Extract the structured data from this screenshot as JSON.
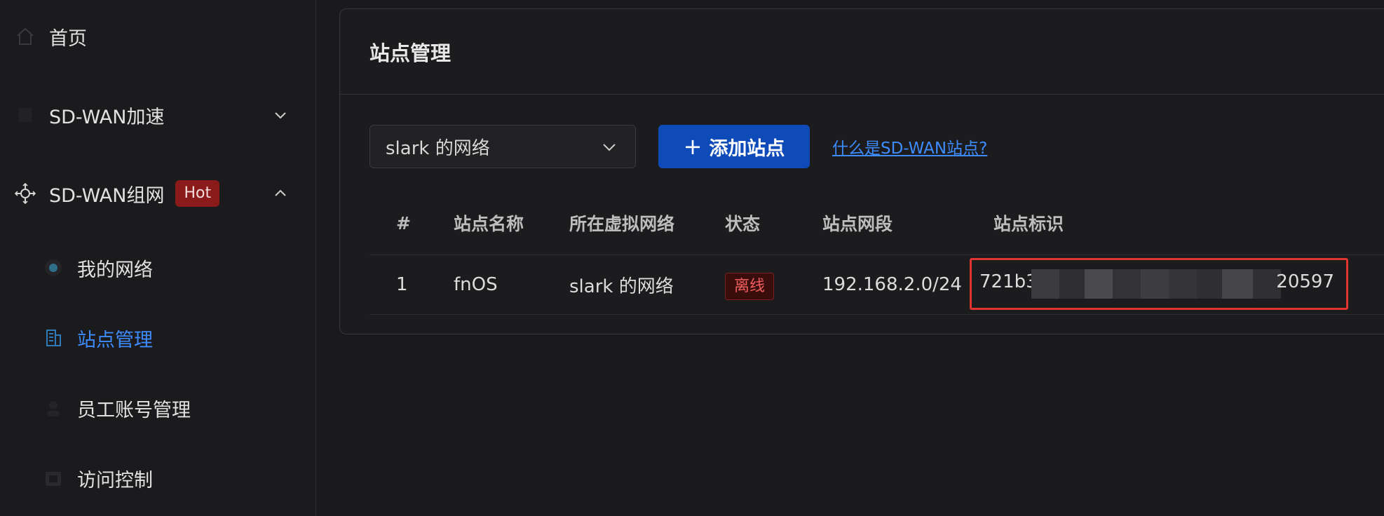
{
  "sidebar": {
    "items": [
      {
        "label": "首页",
        "icon": "home-icon"
      },
      {
        "label": "SD-WAN加速",
        "icon": "accelerate-icon"
      },
      {
        "label": "SD-WAN组网",
        "icon": "network-topology-icon",
        "badge": "Hot"
      },
      {
        "label": "我的网络",
        "icon": "globe-icon"
      },
      {
        "label": "站点管理",
        "icon": "building-icon",
        "active": true
      },
      {
        "label": "员工账号管理",
        "icon": "user-icon"
      },
      {
        "label": "访问控制",
        "icon": "access-control-icon"
      }
    ]
  },
  "main": {
    "title": "站点管理",
    "network_select": {
      "value": "slark 的网络"
    },
    "add_button": {
      "icon": "+",
      "label": "添加站点"
    },
    "help_link": "什么是SD-WAN站点?",
    "table": {
      "columns": [
        "#",
        "站点名称",
        "所在虚拟网络",
        "状态",
        "站点网段",
        "站点标识"
      ],
      "rows": [
        {
          "index": "1",
          "name": "fnOS",
          "network": "slark 的网络",
          "status": "离线",
          "segment": "192.168.2.0/24",
          "id_prefix": "721b3",
          "id_suffix": "20597"
        }
      ]
    }
  },
  "colors": {
    "accent": "#0f4bb8",
    "link": "#3d8bfd",
    "hot_badge": "#8b1a1a",
    "offline_status": "#f05d5d",
    "highlight_box": "#e0352f"
  }
}
